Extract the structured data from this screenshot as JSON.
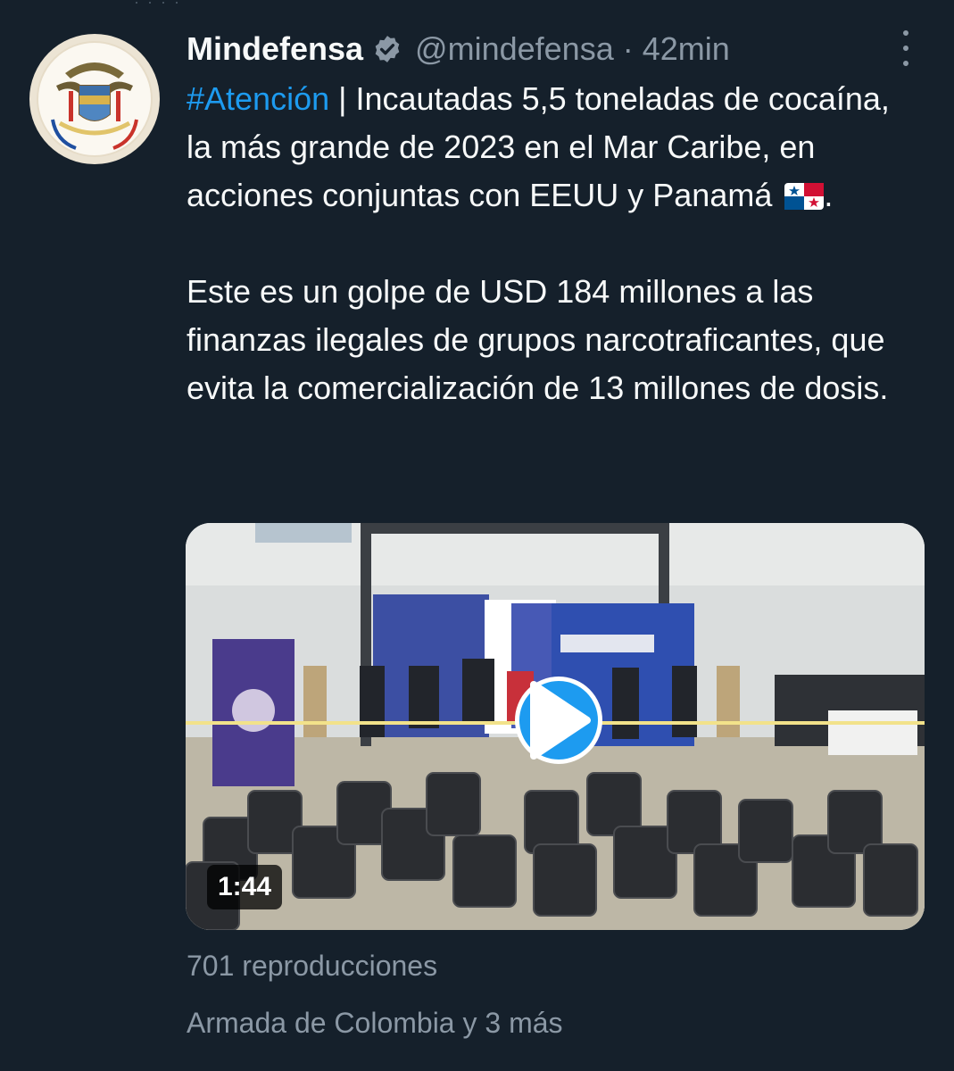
{
  "tweet": {
    "author_name": "Mindefensa",
    "handle": "@mindefensa",
    "separator": "·",
    "time": "42min",
    "hashtag": "#Atención",
    "text_line_1": " | Incautadas 5,5 toneladas de cocaína, la más grande de 2023 en el Mar Caribe, en acciones conjuntas con EEUU y Panamá",
    "text_end": ".",
    "paragraph_2": "Este es un golpe de USD 184 millones a las finanzas ilegales de grupos narcotraficantes, que evita la comercialización de 13 millones de dosis.",
    "video_duration": "1:44",
    "views": "701 reproducciones",
    "tagged": "Armada de Colombia y 3 más"
  },
  "icons": {
    "verified": "verified-badge-icon",
    "more": "more-options-icon",
    "play": "play-icon",
    "flag": "panama-flag-emoji"
  },
  "colors": {
    "background": "#15202b",
    "primary_text": "#f7f9f9",
    "secondary_text": "#8b98a5",
    "accent": "#1d9bf0"
  }
}
